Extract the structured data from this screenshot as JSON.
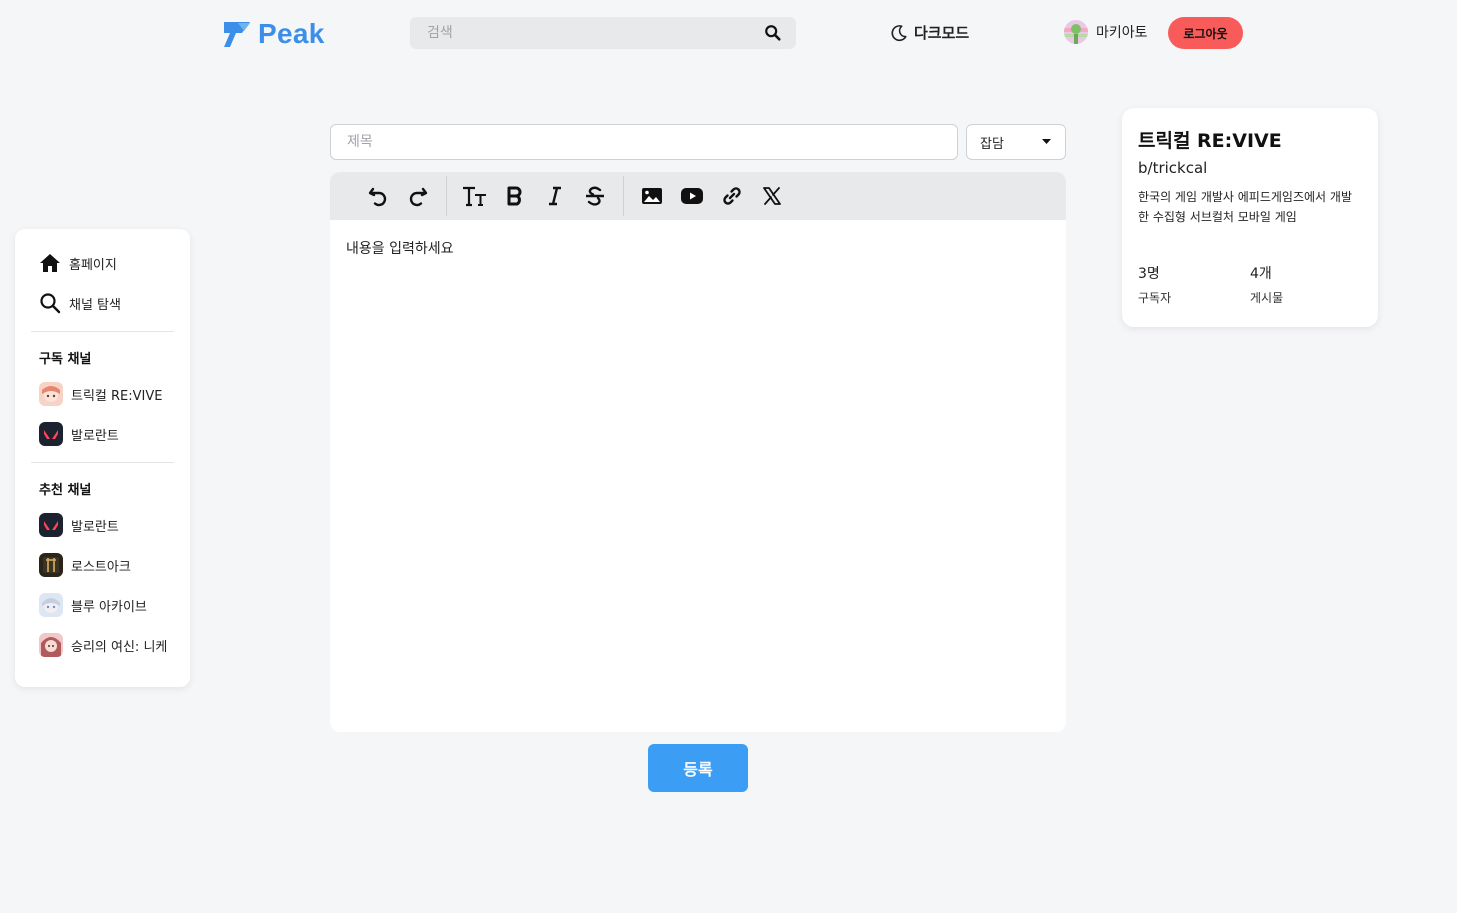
{
  "brand": {
    "name": "Peak",
    "color": "#3b8fe8"
  },
  "header": {
    "search_placeholder": "검색",
    "darkmode_label": "다크모드",
    "username": "마키아토",
    "logout_label": "로그아웃"
  },
  "sidebar": {
    "nav": [
      {
        "label": "홈페이지",
        "icon": "home-icon"
      },
      {
        "label": "채널 탐색",
        "icon": "search-icon"
      }
    ],
    "subscribed_title": "구독 채널",
    "subscribed": [
      {
        "label": "트릭컬 RE:VIVE",
        "icon": "trickcal-icon"
      },
      {
        "label": "발로란트",
        "icon": "valorant-icon"
      }
    ],
    "recommended_title": "추천 채널",
    "recommended": [
      {
        "label": "발로란트",
        "icon": "valorant-icon"
      },
      {
        "label": "로스트아크",
        "icon": "lostark-icon"
      },
      {
        "label": "블루 아카이브",
        "icon": "bluearchive-icon"
      },
      {
        "label": "승리의 여신: 니케",
        "icon": "nikke-icon"
      }
    ]
  },
  "editor": {
    "title_placeholder": "제목",
    "category_selected": "잡담",
    "content_placeholder": "내용을 입력하세요",
    "toolbar": [
      "undo-icon",
      "redo-icon",
      "text-size-icon",
      "bold-icon",
      "italic-icon",
      "strikethrough-icon",
      "image-icon",
      "youtube-icon",
      "link-icon",
      "x-icon"
    ],
    "submit_label": "등록",
    "submit_color": "#3c9df5"
  },
  "channel_card": {
    "title": "트릭컬 RE:VIVE",
    "handle": "b/trickcal",
    "description": "한국의 게임 개발사 에피드게임즈에서 개발한 수집형 서브컬처 모바일 게임",
    "stats": [
      {
        "value": "3명",
        "label": "구독자"
      },
      {
        "value": "4개",
        "label": "게시물"
      }
    ]
  },
  "colors": {
    "logout": "#f95b5b",
    "background": "#f5f6f8"
  }
}
